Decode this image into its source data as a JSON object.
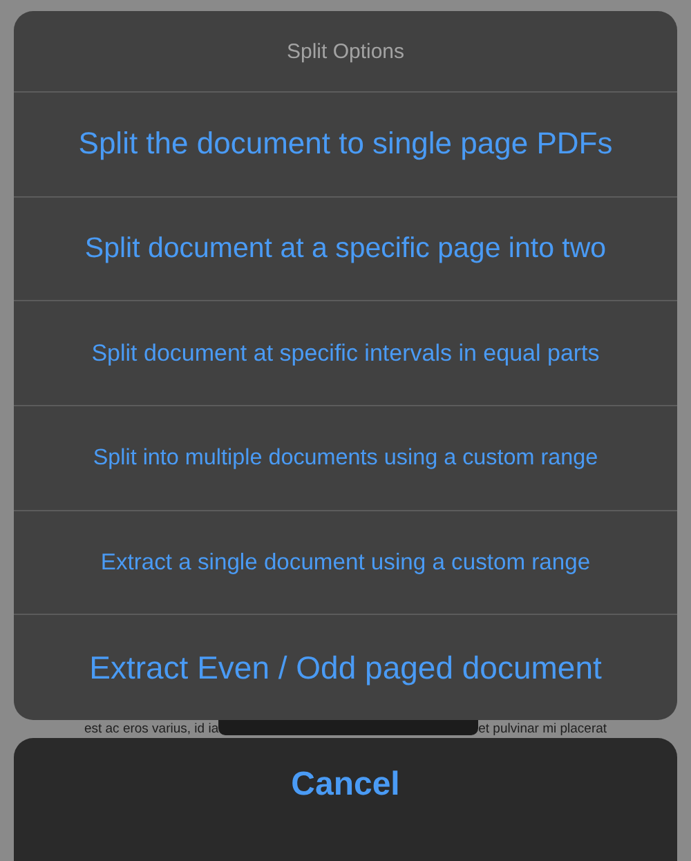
{
  "action_sheet": {
    "title": "Split Options",
    "options": [
      {
        "label": "Split the document to single page PDFs"
      },
      {
        "label": "Split document at a specific page into two"
      },
      {
        "label": "Split document at specific intervals in equal parts"
      },
      {
        "label": "Split into multiple documents using a custom range"
      },
      {
        "label": "Extract a single document using a custom range"
      },
      {
        "label": "Extract Even / Odd paged document"
      }
    ]
  },
  "background_text": [
    "est ac eros varius, id ia",
    "et pulvinar mi placerat"
  ],
  "cancel_button": "Cancel"
}
